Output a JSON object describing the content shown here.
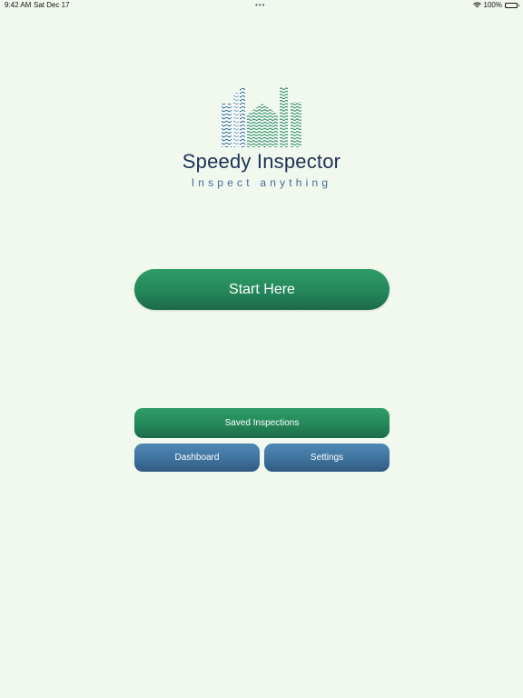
{
  "status_bar": {
    "time": "9:42 AM",
    "date": "Sat Dec 17",
    "multitask_dots": "•••",
    "battery": "100%",
    "icons": [
      "wifi-icon",
      "battery-icon"
    ]
  },
  "app": {
    "title": "Speedy Inspector",
    "subtitle": "Inspect anything",
    "logo_icon": "city-buildings-logo"
  },
  "buttons": {
    "start": "Start Here",
    "saved": "Saved Inspections",
    "dashboard": "Dashboard",
    "settings": "Settings"
  },
  "colors": {
    "background": "#f1f9ef",
    "green_button": "#24875a",
    "blue_button": "#3f739e",
    "title": "#1e3157",
    "subtitle": "#3e6b9a"
  }
}
